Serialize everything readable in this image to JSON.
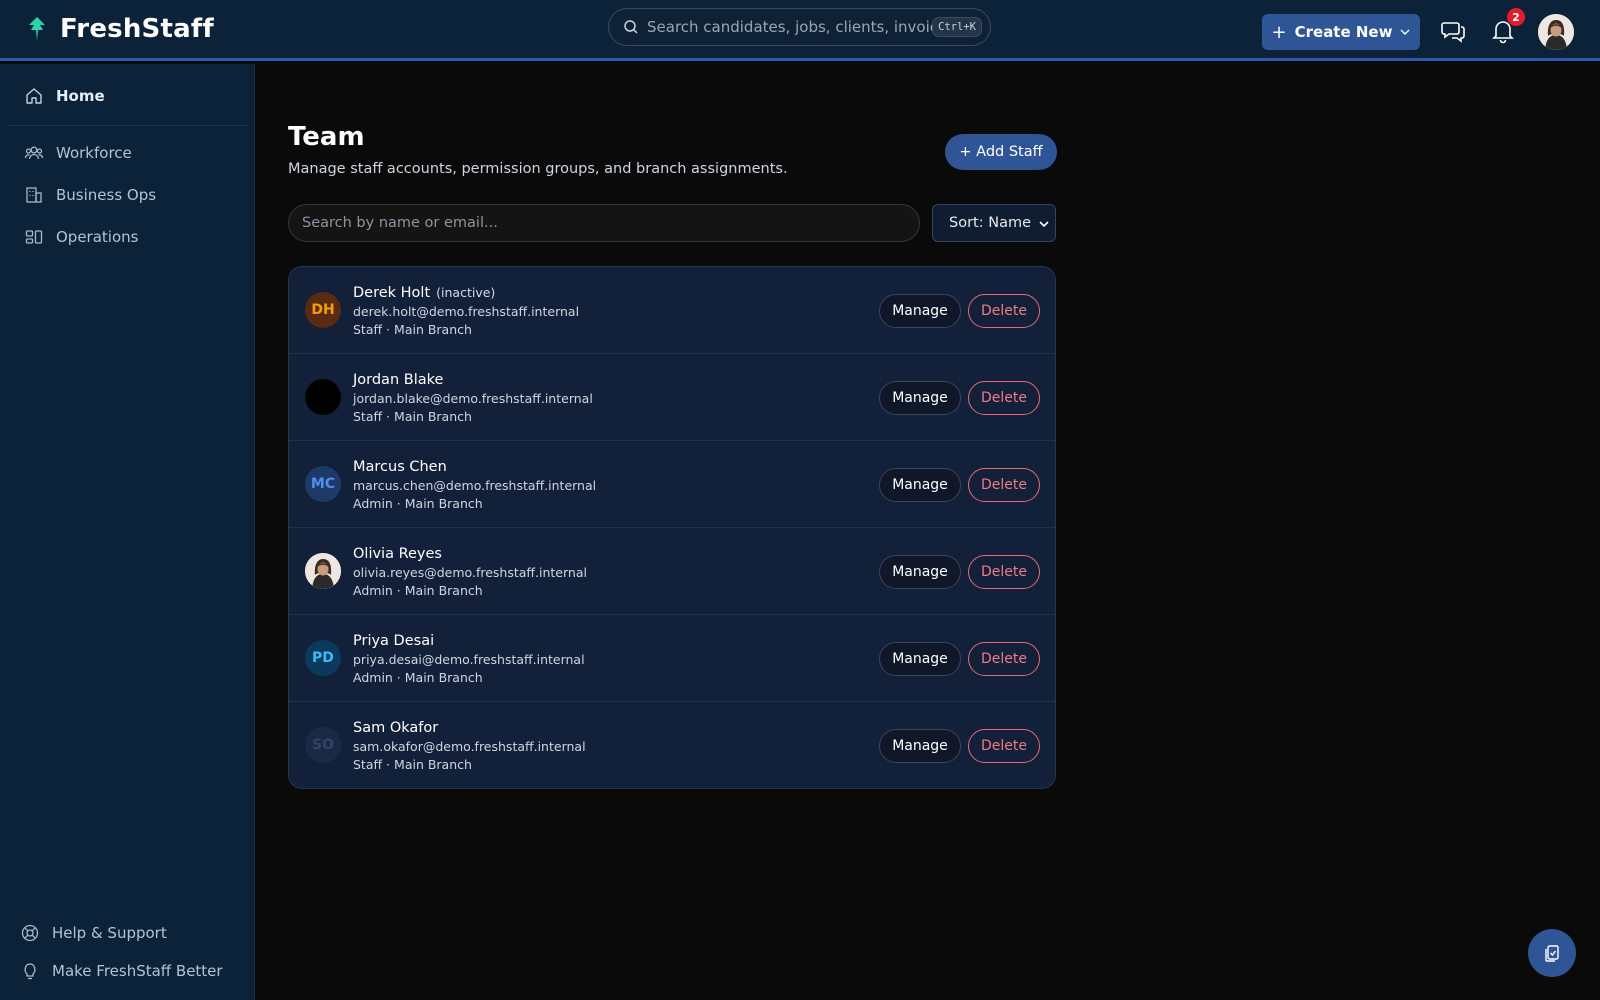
{
  "app": {
    "name": "FreshStaff"
  },
  "header": {
    "search_placeholder": "Search candidates, jobs, clients, invoices...",
    "shortcut": "Ctrl+K",
    "create_label": "Create New",
    "notification_count": "2"
  },
  "sidebar": {
    "items": [
      {
        "label": "Home",
        "icon": "home-icon",
        "active": true
      },
      {
        "label": "Workforce",
        "icon": "users-icon"
      },
      {
        "label": "Business Ops",
        "icon": "building-icon"
      },
      {
        "label": "Operations",
        "icon": "layout-icon"
      }
    ],
    "footer": [
      {
        "label": "Help & Support",
        "icon": "lifebuoy-icon"
      },
      {
        "label": "Make FreshStaff Better",
        "icon": "lightbulb-icon"
      }
    ]
  },
  "main": {
    "title": "Team",
    "subtitle": "Manage staff accounts, permission groups, and branch assignments.",
    "add_staff_label": "+ Add Staff",
    "search_placeholder": "Search by name or email...",
    "sort_label": "Sort: Name",
    "manage_label": "Manage",
    "delete_label": "Delete",
    "staff": [
      {
        "initials": "DH",
        "name": "Derek Holt",
        "status": "(inactive)",
        "email": "derek.holt@demo.freshstaff.internal",
        "meta": "Staff · Main Branch",
        "avatar_bg": "#5a2a12",
        "avatar_fg": "#f59e0b"
      },
      {
        "initials": "",
        "name": "Jordan Blake",
        "status": "",
        "email": "jordan.blake@demo.freshstaff.internal",
        "meta": "Staff · Main Branch",
        "avatar_bg": "#000000",
        "avatar_fg": "#000000"
      },
      {
        "initials": "MC",
        "name": "Marcus Chen",
        "status": "",
        "email": "marcus.chen@demo.freshstaff.internal",
        "meta": "Admin · Main Branch",
        "avatar_bg": "#1e3a66",
        "avatar_fg": "#4f8ff0"
      },
      {
        "initials": "",
        "name": "Olivia Reyes",
        "status": "",
        "email": "olivia.reyes@demo.freshstaff.internal",
        "meta": "Admin · Main Branch",
        "avatar_bg": "#e8e4df",
        "avatar_fg": "#000000"
      },
      {
        "initials": "PD",
        "name": "Priya Desai",
        "status": "",
        "email": "priya.desai@demo.freshstaff.internal",
        "meta": "Admin · Main Branch",
        "avatar_bg": "#0b3a5e",
        "avatar_fg": "#38bdf8"
      },
      {
        "initials": "SO",
        "name": "Sam Okafor",
        "status": "",
        "email": "sam.okafor@demo.freshstaff.internal",
        "meta": "Staff · Main Branch",
        "avatar_bg": "#1b2a44",
        "avatar_fg": "#2f4468"
      }
    ]
  },
  "colors": {
    "accent": "#2f5597",
    "danger": "#f07b83",
    "sidebar_bg": "#0c2238"
  }
}
